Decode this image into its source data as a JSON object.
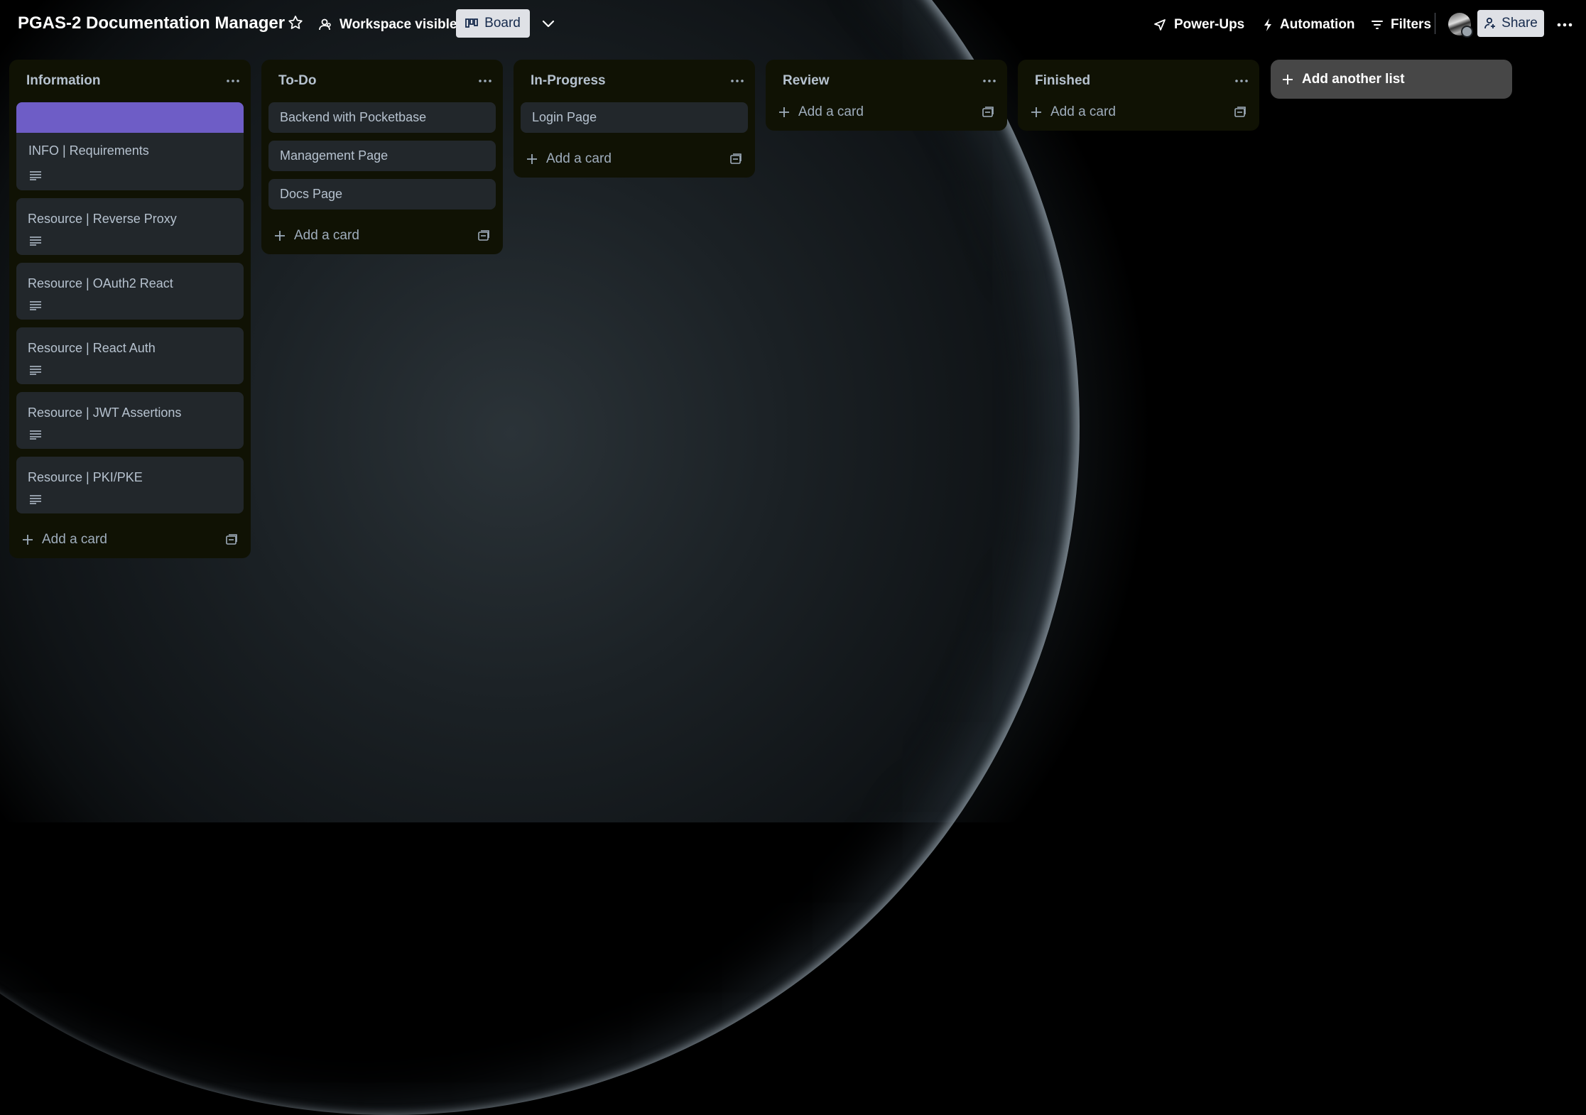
{
  "header": {
    "board_title": "PGAS-2 Documentation Manager",
    "visibility_label": "Workspace visible",
    "view_label": "Board",
    "power_ups_label": "Power-Ups",
    "automation_label": "Automation",
    "filters_label": "Filters",
    "share_label": "Share"
  },
  "lists": [
    {
      "title": "Information",
      "cards": [
        {
          "title": "INFO | Requirements",
          "cover_color": "#6e5dc6",
          "has_description": true
        },
        {
          "title": "Resource | Reverse Proxy",
          "has_description": true
        },
        {
          "title": "Resource | OAuth2 React",
          "has_description": true
        },
        {
          "title": "Resource | React Auth",
          "has_description": true
        },
        {
          "title": "Resource | JWT Assertions",
          "has_description": true
        },
        {
          "title": "Resource | PKI/PKE",
          "has_description": true
        }
      ],
      "add_card_label": "Add a card"
    },
    {
      "title": "To-Do",
      "cards": [
        {
          "title": "Backend with Pocketbase"
        },
        {
          "title": "Management Page"
        },
        {
          "title": "Docs Page"
        }
      ],
      "add_card_label": "Add a card"
    },
    {
      "title": "In-Progress",
      "cards": [
        {
          "title": "Login Page"
        }
      ],
      "add_card_label": "Add a card"
    },
    {
      "title": "Review",
      "cards": [],
      "add_card_label": "Add a card"
    },
    {
      "title": "Finished",
      "cards": [],
      "add_card_label": "Add a card"
    }
  ],
  "add_list_label": "Add another list",
  "colors": {
    "list_bg": "#101204",
    "card_bg": "#22272b",
    "cover_purple": "#6e5dc6",
    "text": "#b6c2cf"
  }
}
